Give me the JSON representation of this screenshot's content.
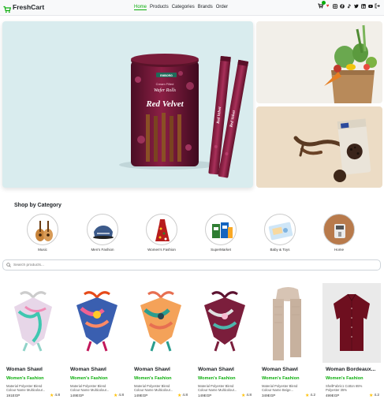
{
  "brand": {
    "name": "FreshCart",
    "icon": "cart-icon",
    "accent": "#0aad0a"
  },
  "nav": {
    "links": [
      {
        "label": "Home",
        "active": true
      },
      {
        "label": "Products",
        "active": false
      },
      {
        "label": "Categories",
        "active": false
      },
      {
        "label": "Brands",
        "active": false
      },
      {
        "label": "Order",
        "active": false
      }
    ],
    "icons": [
      "cart-icon",
      "heart-icon",
      "instagram-icon",
      "facebook-icon",
      "tiktok-icon",
      "twitter-icon",
      "linkedin-icon",
      "youtube-icon",
      "logout-icon"
    ]
  },
  "hero": {
    "main_product": {
      "brand": "EMBORG",
      "line1": "Cream Filled",
      "line2": "Wafer Rolls",
      "flavor": "Red Velvet"
    },
    "side_top": "groceries-bag-image",
    "side_bottom": "chocolate-cookies-image"
  },
  "categories": {
    "title": "Shop by Category",
    "items": [
      {
        "label": "Music",
        "icon": "guitar-icon"
      },
      {
        "label": "Men's Fashion",
        "icon": "mens-fashion-icon"
      },
      {
        "label": "Women's Fashion",
        "icon": "womens-fashion-icon"
      },
      {
        "label": "SuperMarket",
        "icon": "supermarket-icon"
      },
      {
        "label": "Baby & Toys",
        "icon": "baby-toys-icon"
      },
      {
        "label": "Home",
        "icon": "home-goods-icon"
      }
    ]
  },
  "search": {
    "placeholder": "Search products...",
    "icon": "search-icon"
  },
  "products": [
    {
      "title": "Woman Shawl",
      "category": "Women's Fashion",
      "desc1": "Material Polyester Blend",
      "desc2": "Colour Name Multicolour...",
      "price": "191EGP",
      "rating": "4.8",
      "image": "scarf-pastel"
    },
    {
      "title": "Woman Shawl",
      "category": "Women's Fashion",
      "desc1": "Material Polyester Blend",
      "desc2": "Colour Name Multicolour...",
      "price": "149EGP",
      "rating": "4.8",
      "image": "scarf-blue-pink"
    },
    {
      "title": "Woman Shawl",
      "category": "Women's Fashion",
      "desc1": "Material Polyester Blend",
      "desc2": "Colour Name Multicolour...",
      "price": "149EGP",
      "rating": "4.8",
      "image": "scarf-orange-teal"
    },
    {
      "title": "Woman Shawl",
      "category": "Women's Fashion",
      "desc1": "Material Polyester Blend",
      "desc2": "Colour Name Multicolour...",
      "price": "149EGP",
      "rating": "4.8",
      "image": "scarf-burgundy"
    },
    {
      "title": "Woman Shawl",
      "category": "Women's Fashion",
      "desc1": "Material Polyester Blend",
      "desc2": "Colour Name Beige...",
      "price": "349EGP",
      "rating": "4.2",
      "image": "scarf-beige"
    },
    {
      "title": "Woman Bordeaux...",
      "category": "Women's Fashion",
      "desc1": "ShellFabric1 Cotton 65%",
      "desc2": "Polyester 35%",
      "price": "499EGP",
      "rating": "4.2",
      "image": "shirt-bordeaux"
    }
  ]
}
